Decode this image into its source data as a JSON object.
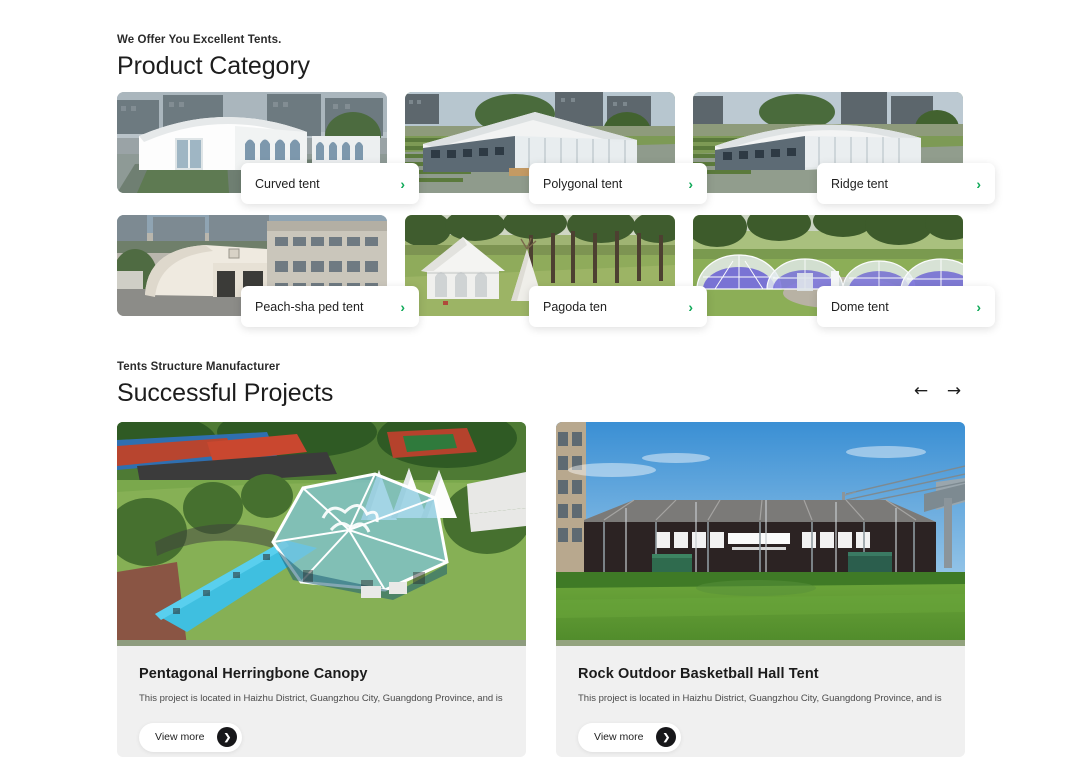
{
  "product_section": {
    "eyebrow": "We Offer You Excellent Tents.",
    "title": "Product Category",
    "categories": [
      {
        "label": "Curved tent",
        "arrow": "›",
        "icon": "chevron-right-icon"
      },
      {
        "label": "Polygonal tent",
        "arrow": "›",
        "icon": "chevron-right-icon"
      },
      {
        "label": "Ridge tent",
        "arrow": "›",
        "icon": "chevron-right-icon"
      },
      {
        "label": "Peach-sha ped tent",
        "arrow": "›",
        "icon": "chevron-right-icon"
      },
      {
        "label": "Pagoda ten",
        "arrow": "›",
        "icon": "chevron-right-icon"
      },
      {
        "label": "Dome tent",
        "arrow": "›",
        "icon": "chevron-right-icon"
      }
    ]
  },
  "projects_section": {
    "eyebrow": "Tents Structure Manufacturer",
    "title": "Successful Projects",
    "nav": {
      "prev": "←",
      "next": "→"
    },
    "projects": [
      {
        "title": "Pentagonal Herringbone Canopy",
        "description": "This project is located in Haizhu District, Guangzhou City, Guangdong Province, and is used for",
        "button_label": "View more",
        "button_arrow": "❯"
      },
      {
        "title": "Rock Outdoor Basketball Hall Tent",
        "description": "This project is located in Haizhu District, Guangzhou City, Guangdong Province, and is used for",
        "button_label": "View more",
        "button_arrow": "❯"
      }
    ]
  },
  "colors": {
    "accent_green": "#0fa958",
    "card_bg": "#f0f0f0",
    "text_dark": "#1d1d1d",
    "button_dark": "#17171a"
  }
}
